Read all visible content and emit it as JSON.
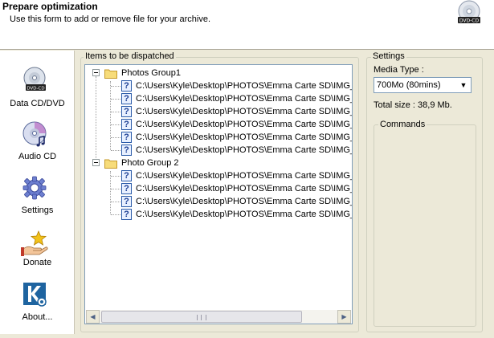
{
  "header": {
    "title": "Prepare optimization",
    "subtitle": "Use this form to add or remove file for your archive."
  },
  "sidebar": {
    "items": [
      {
        "label": "Data CD/DVD",
        "icon": "dvd-cd-icon"
      },
      {
        "label": "Audio CD",
        "icon": "audio-cd-icon"
      },
      {
        "label": "Settings",
        "icon": "settings-gear-icon"
      },
      {
        "label": "Donate",
        "icon": "donate-hand-icon"
      },
      {
        "label": "About...",
        "icon": "about-k-icon"
      }
    ]
  },
  "items_panel": {
    "label": "Items to be dispatched",
    "groups": [
      {
        "name": "Photos Group1",
        "files": [
          "C:\\Users\\Kyle\\Desktop\\PHOTOS\\Emma Carte SD\\IMG_",
          "C:\\Users\\Kyle\\Desktop\\PHOTOS\\Emma Carte SD\\IMG_",
          "C:\\Users\\Kyle\\Desktop\\PHOTOS\\Emma Carte SD\\IMG_",
          "C:\\Users\\Kyle\\Desktop\\PHOTOS\\Emma Carte SD\\IMG_",
          "C:\\Users\\Kyle\\Desktop\\PHOTOS\\Emma Carte SD\\IMG_",
          "C:\\Users\\Kyle\\Desktop\\PHOTOS\\Emma Carte SD\\IMG_"
        ]
      },
      {
        "name": "Photo Group 2",
        "files": [
          "C:\\Users\\Kyle\\Desktop\\PHOTOS\\Emma Carte SD\\IMG_",
          "C:\\Users\\Kyle\\Desktop\\PHOTOS\\Emma Carte SD\\IMG_",
          "C:\\Users\\Kyle\\Desktop\\PHOTOS\\Emma Carte SD\\IMG_",
          "C:\\Users\\Kyle\\Desktop\\PHOTOS\\Emma Carte SD\\IMG_"
        ]
      }
    ]
  },
  "settings_panel": {
    "label": "Settings",
    "media_type_label": "Media Type :",
    "media_type_value": "700Mo (80mins)",
    "total_size": "Total size : 38,9 Mb.",
    "commands_label": "Commands"
  },
  "colors": {
    "window_bg": "#ece9d8",
    "header_bg": "#ffffff",
    "tree_border": "#7f9db9",
    "icon_blue": "#1c3f94"
  }
}
